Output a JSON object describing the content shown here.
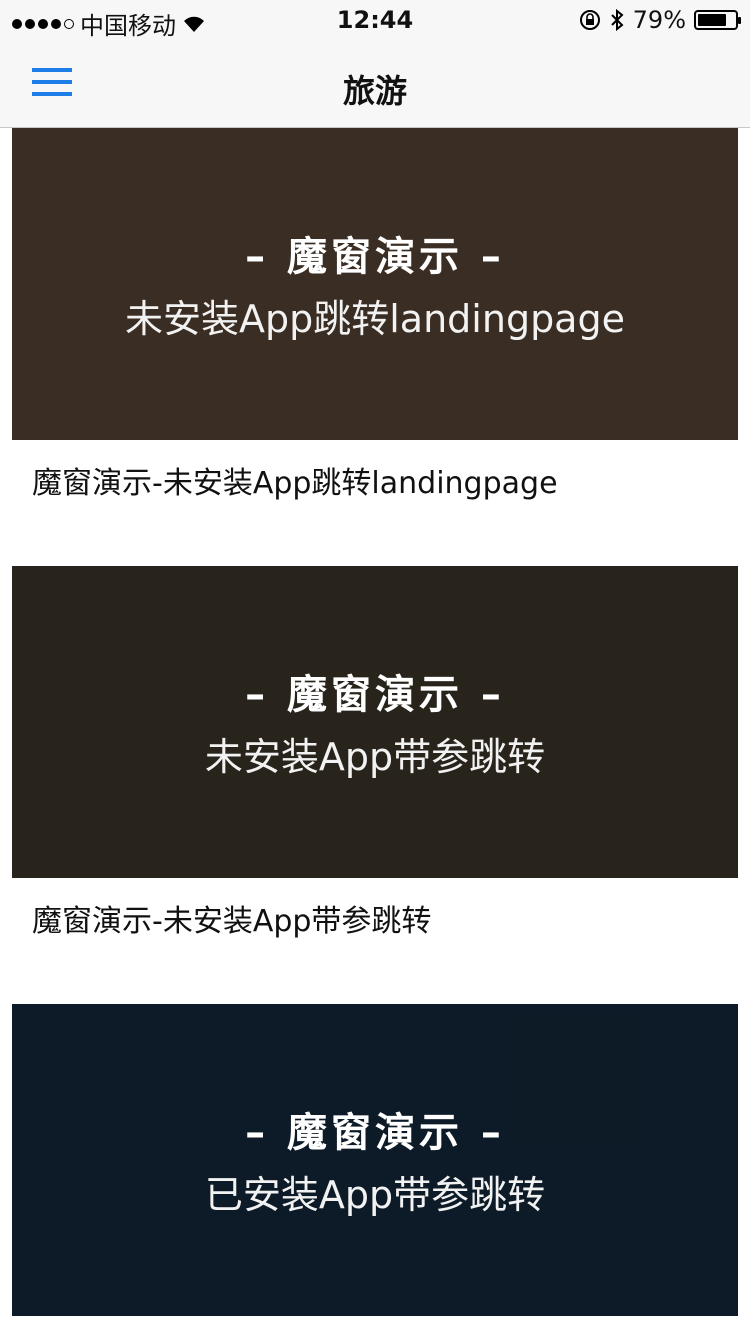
{
  "status_bar": {
    "carrier": "中国移动",
    "time": "12:44",
    "battery": "79%",
    "battery_level": 0.79
  },
  "navbar": {
    "title": "旅游",
    "menu_icon": "hamburger-menu-icon",
    "accent": "#1e7ee8"
  },
  "cards": [
    {
      "headline": "– 魔窗演示 –",
      "subtitle": "未安装App跳转landingpage",
      "caption": "魔窗演示-未安装App跳转landingpage",
      "bg": "#6b5340"
    },
    {
      "headline": "– 魔窗演示 –",
      "subtitle": "未安装App带参跳转",
      "caption": "魔窗演示-未安装App带参跳转",
      "bg": "#4a4233"
    },
    {
      "headline": "– 魔窗演示 –",
      "subtitle": "已安装App带参跳转",
      "caption": "",
      "bg": "#173247"
    }
  ]
}
